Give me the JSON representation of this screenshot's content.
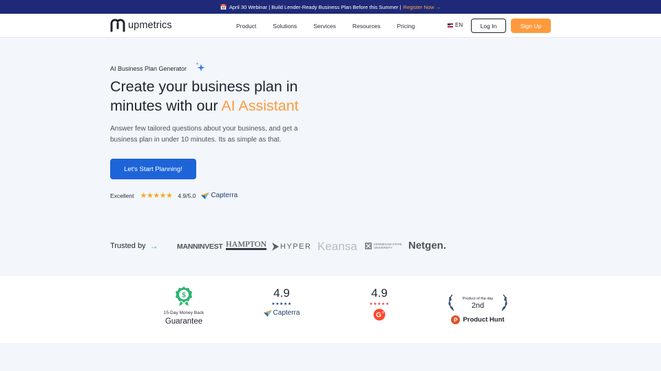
{
  "banner": {
    "icon": "calendar-icon",
    "text": "April 30 Webinar | Build Lender-Ready Business Plan Before this Summer |",
    "link": "Register Now →"
  },
  "nav": {
    "brand": "upmetrics",
    "menu": [
      "Product",
      "Solutions",
      "Services",
      "Resources",
      "Pricing"
    ],
    "language": "EN",
    "login": "Log In",
    "signup": "Sign Up"
  },
  "hero": {
    "eyebrow": "AI Business Plan Generator",
    "headline_part1": "Create your business plan in minutes with our ",
    "headline_accent": "AI Assistant",
    "subtext": "Answer few tailored questions about your business, and get a business plan in under 10 minutes. Its as simple as that.",
    "cta": "Let's Start Planning!",
    "rating_label": "Excellent",
    "stars": "★★★★★",
    "score": "4.9/5.0",
    "rating_source": "Capterra"
  },
  "trusted": {
    "label": "Trusted by",
    "arrow": "→",
    "logos": [
      "MANNINVEST",
      "HAMPTON",
      "HYPER",
      "Keansa",
      "KENNESAW STATE UNIVERSITY",
      "Netgen."
    ]
  },
  "stats": {
    "guarantee_small": "15-Day Money Back",
    "guarantee_big": "Guarantee",
    "capterra_score": "4.9",
    "capterra_stars": "★★★★★",
    "capterra_name": "Capterra",
    "g2_score": "4.9",
    "g2_stars": "★★★★★",
    "ph_top": "Product of the day",
    "ph_rank": "2nd",
    "ph_name": "Product Hunt"
  },
  "colors": {
    "banner": "#1e2a78",
    "accent_orange": "#ff9a3c",
    "primary_blue": "#1d64d8",
    "green": "#2bb673"
  }
}
